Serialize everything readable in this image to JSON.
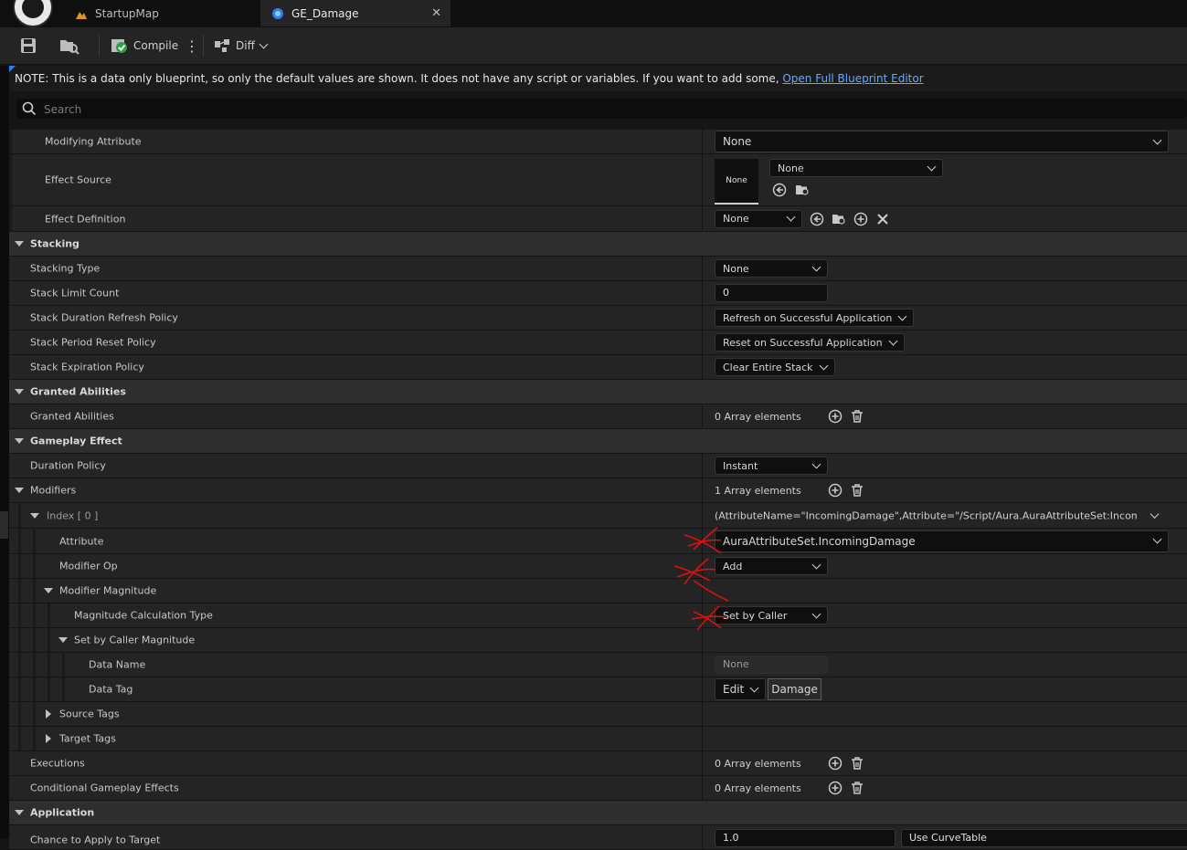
{
  "tabs": [
    {
      "label": "StartupMap",
      "icon": "level-map-icon"
    },
    {
      "label": "GE_Damage",
      "icon": "blueprint-icon"
    }
  ],
  "toolbar": {
    "compile_label": "Compile",
    "diff_label": "Diff"
  },
  "note": {
    "text": "NOTE: This is a data only blueprint, so only the default values are shown.  It does not have any script or variables.  If you want to add some, ",
    "link": "Open Full Blueprint Editor"
  },
  "search": {
    "placeholder": "Search"
  },
  "rows": {
    "modifying_attribute": {
      "label": "Modifying Attribute",
      "value": "None"
    },
    "effect_source": {
      "label": "Effect Source",
      "thumb": "None",
      "value": "None"
    },
    "effect_definition": {
      "label": "Effect Definition",
      "value": "None"
    },
    "stacking": {
      "label": "Stacking"
    },
    "stacking_type": {
      "label": "Stacking Type",
      "value": "None"
    },
    "stack_limit_count": {
      "label": "Stack Limit Count",
      "value": "0"
    },
    "stack_duration_refresh": {
      "label": "Stack Duration Refresh Policy",
      "value": "Refresh on Successful Application"
    },
    "stack_period_reset": {
      "label": "Stack Period Reset Policy",
      "value": "Reset on Successful Application"
    },
    "stack_expiration": {
      "label": "Stack Expiration Policy",
      "value": "Clear Entire Stack"
    },
    "granted_abilities_cat": {
      "label": "Granted Abilities"
    },
    "granted_abilities": {
      "label": "Granted Abilities",
      "value": "0 Array elements"
    },
    "gameplay_effect": {
      "label": "Gameplay Effect"
    },
    "duration_policy": {
      "label": "Duration Policy",
      "value": "Instant"
    },
    "modifiers": {
      "label": "Modifiers",
      "value": "1 Array elements"
    },
    "index0": {
      "label": "Index [ 0 ]",
      "value": "(AttributeName=\"IncomingDamage\",Attribute=\"/Script/Aura.AuraAttributeSet:IncomingDama"
    },
    "attribute": {
      "label": "Attribute",
      "value": "AuraAttributeSet.IncomingDamage"
    },
    "modifier_op": {
      "label": "Modifier Op",
      "value": "Add"
    },
    "modifier_magnitude": {
      "label": "Modifier Magnitude"
    },
    "magnitude_calc_type": {
      "label": "Magnitude Calculation Type",
      "value": "Set by Caller"
    },
    "set_by_caller_magnitude": {
      "label": "Set by Caller Magnitude"
    },
    "data_name": {
      "label": "Data Name",
      "value": "None"
    },
    "data_tag": {
      "label": "Data Tag",
      "edit": "Edit",
      "value": "Damage"
    },
    "source_tags": {
      "label": "Source Tags"
    },
    "target_tags": {
      "label": "Target Tags"
    },
    "executions": {
      "label": "Executions",
      "value": "0 Array elements"
    },
    "conditional_effects": {
      "label": "Conditional Gameplay Effects",
      "value": "0 Array elements"
    },
    "application": {
      "label": "Application"
    },
    "chance_to_apply": {
      "label": "Chance to Apply to Target",
      "value": "1.0",
      "curve": "Use CurveTable"
    }
  },
  "colors": {
    "accent": "#2f7cf6",
    "link": "#66a8ff",
    "annotation": "#e01010"
  }
}
